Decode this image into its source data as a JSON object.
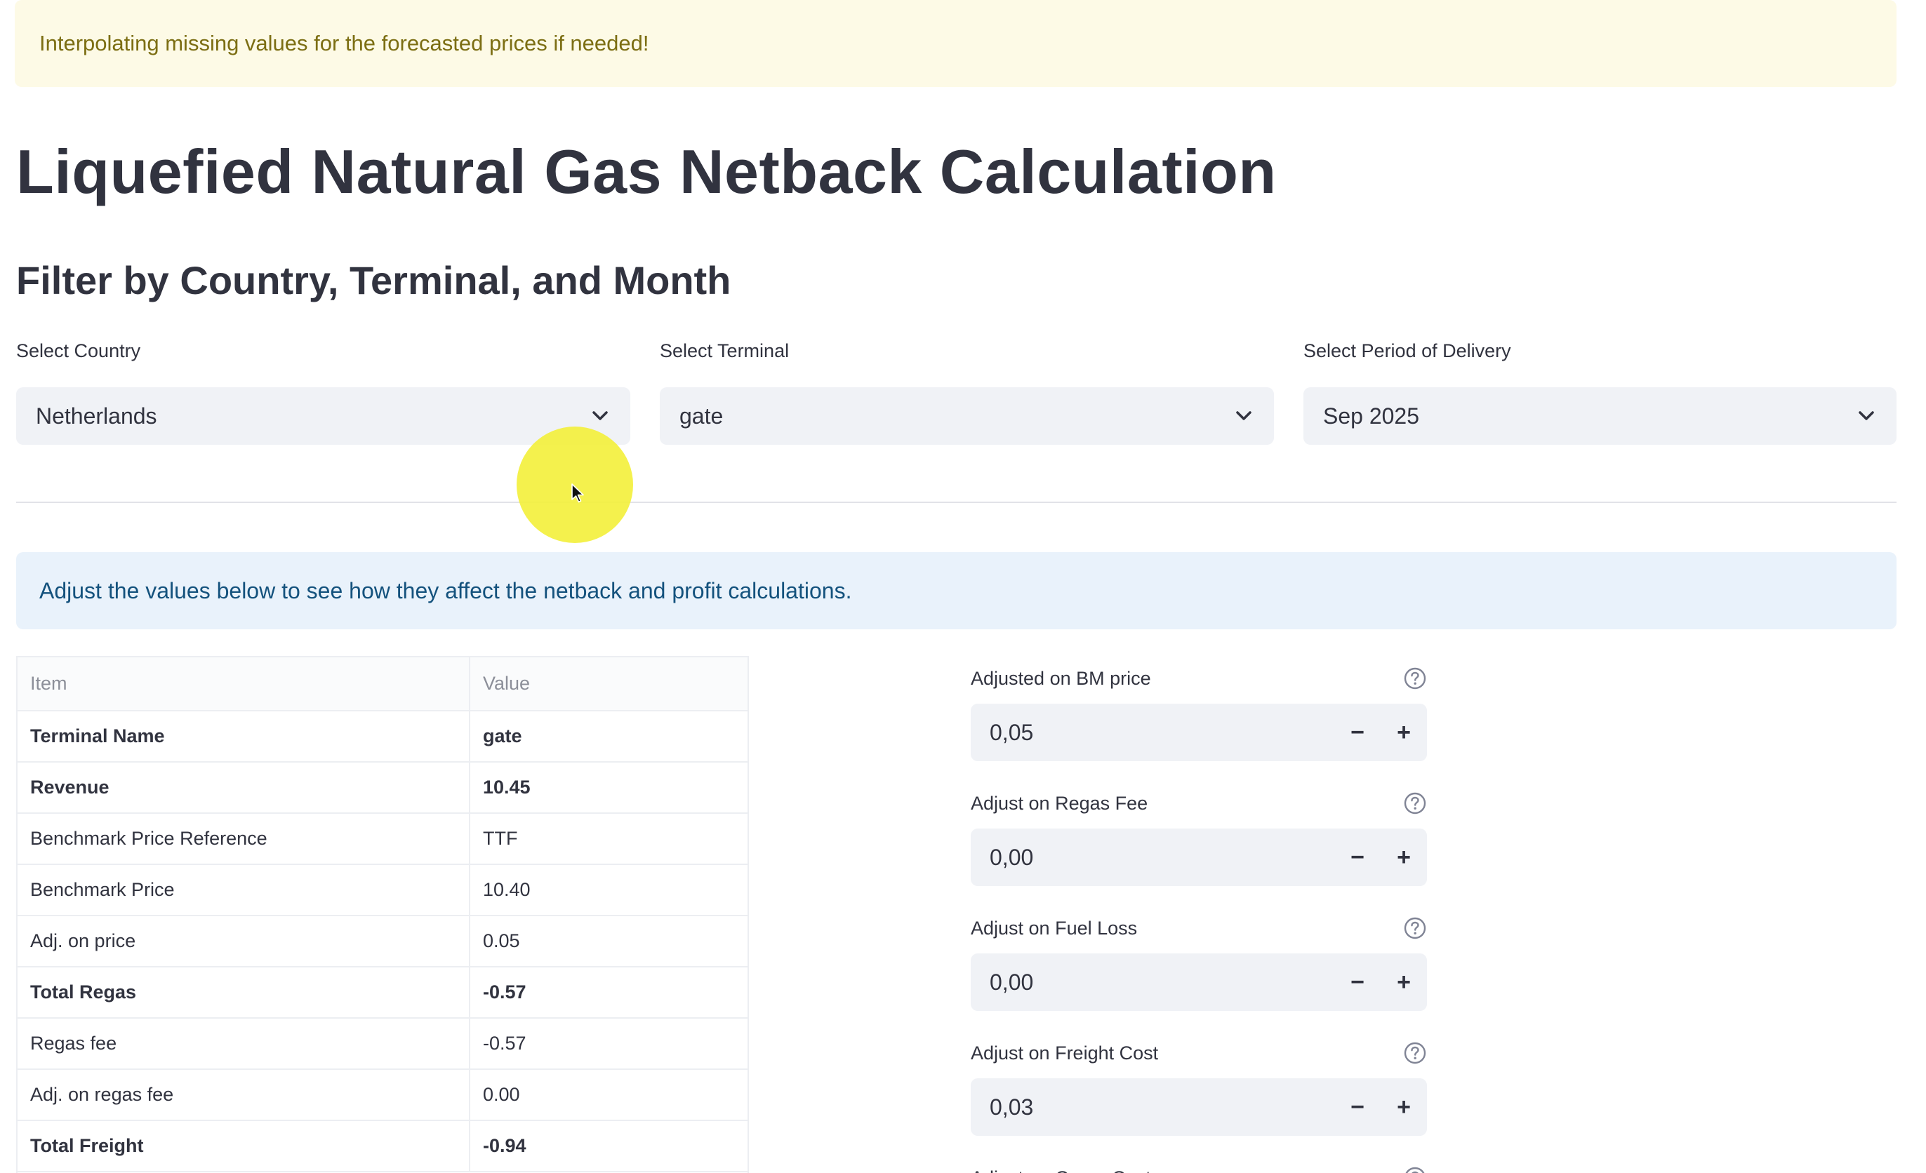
{
  "warning_text": "Interpolating missing values for the forecasted prices if needed!",
  "title": "Liquefied Natural Gas Netback Calculation",
  "subtitle": "Filter by Country, Terminal, and Month",
  "filters": {
    "country": {
      "label": "Select Country",
      "value": "Netherlands"
    },
    "terminal": {
      "label": "Select Terminal",
      "value": "gate"
    },
    "period": {
      "label": "Select Period of Delivery",
      "value": "Sep 2025"
    }
  },
  "info_text": "Adjust the values below to see how they affect the netback and profit calculations.",
  "table": {
    "headers": [
      "Item",
      "Value"
    ],
    "rows": [
      {
        "item": "Terminal Name",
        "value": "gate",
        "bold": true
      },
      {
        "item": "Revenue",
        "value": "10.45",
        "bold": true
      },
      {
        "item": "Benchmark Price Reference",
        "value": "TTF",
        "bold": false
      },
      {
        "item": "Benchmark Price",
        "value": "10.40",
        "bold": false
      },
      {
        "item": "Adj. on price",
        "value": "0.05",
        "bold": false
      },
      {
        "item": "Total Regas",
        "value": "-0.57",
        "bold": true
      },
      {
        "item": "Regas fee",
        "value": "-0.57",
        "bold": false
      },
      {
        "item": "Adj. on regas fee",
        "value": "0.00",
        "bold": false
      },
      {
        "item": "Total Freight",
        "value": "-0.94",
        "bold": true
      }
    ]
  },
  "adjustments": [
    {
      "label": "Adjusted on BM price",
      "value": "0,05"
    },
    {
      "label": "Adjust on Regas Fee",
      "value": "0,00"
    },
    {
      "label": "Adjust on Fuel Loss",
      "value": "0,00"
    },
    {
      "label": "Adjust on Freight Cost",
      "value": "0,03"
    },
    {
      "label": "Adjust on Cargo Cost",
      "value": ""
    }
  ],
  "stepper": {
    "minus": "−",
    "plus": "+"
  },
  "icons": {
    "dropdown": "chevron-down-icon",
    "help": "help-circle-icon",
    "cursor": "mouse-pointer-icon"
  },
  "colors": {
    "warning_bg": "#fdfae6",
    "warning_text": "#7c6e13",
    "info_bg": "#e9f2fb",
    "info_text": "#14527d",
    "input_bg": "#f0f2f6",
    "cursor_highlight": "#f3ef3a"
  }
}
